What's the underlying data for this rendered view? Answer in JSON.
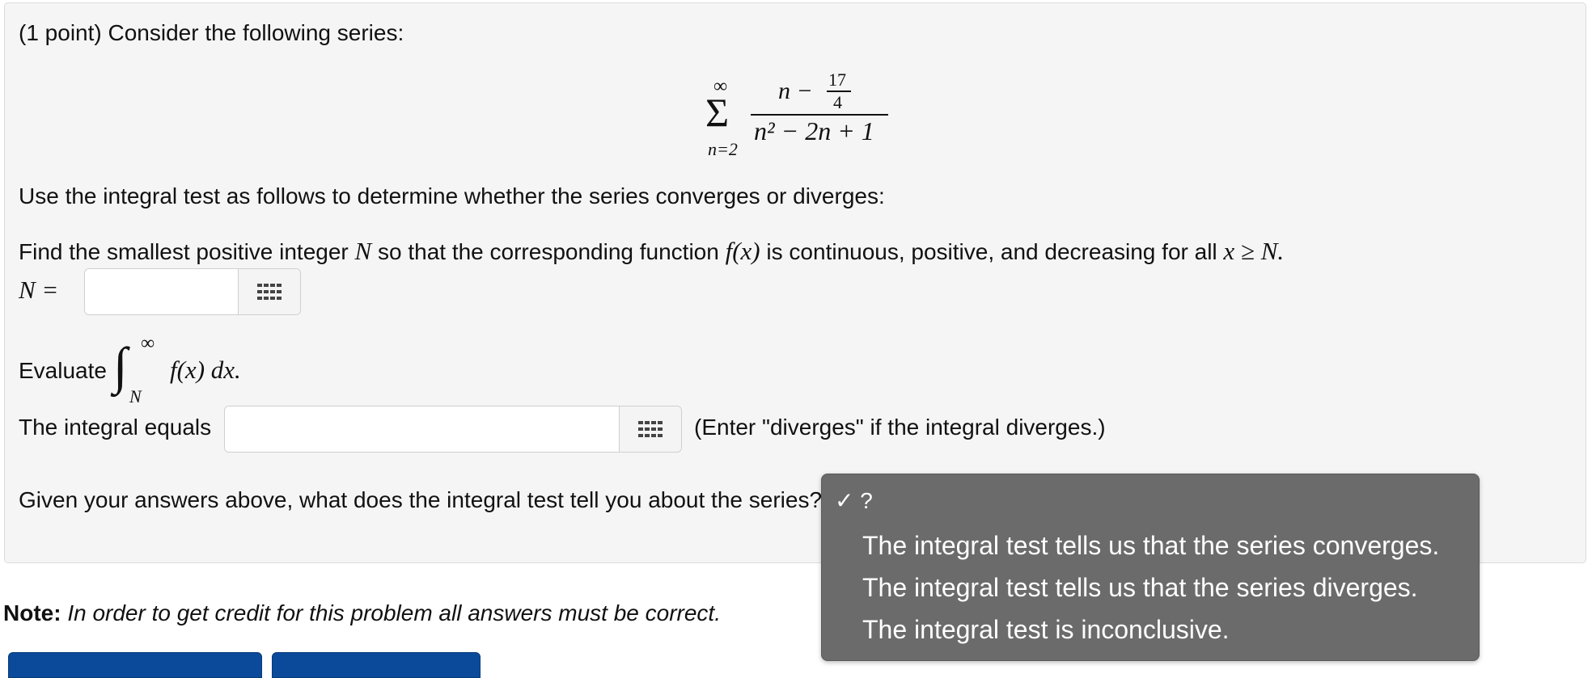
{
  "problem": {
    "intro": "(1 point) Consider the following series:",
    "series": {
      "upper": "∞",
      "lower": "n=2",
      "sigma": "Σ",
      "num_var": "n −",
      "frac_num": "17",
      "frac_den": "4",
      "den": "n² − 2n + 1"
    },
    "instruction": "Use the integral test as follows to determine whether the series converges or diverges:",
    "find_parts": {
      "a": "Find the smallest positive integer ",
      "N": "N",
      "b": " so that the corresponding function ",
      "fx": "f(x)",
      "c": " is continuous, positive, and decreasing for all ",
      "xgeN": "x ≥ N."
    },
    "n_label": "N =",
    "n_value": "",
    "evaluate": {
      "label": "Evaluate",
      "integral": "∫",
      "upper": "∞",
      "lower": "N",
      "integrand": "f(x) dx."
    },
    "integral_label": "The integral equals",
    "integral_value": "",
    "integral_hint": "(Enter \"diverges\" if the integral diverges.)",
    "question": "Given your answers above, what does the integral test tell you about the series?"
  },
  "dropdown": {
    "selected_mark": "✓ ?",
    "options": [
      "The integral test tells us that the series converges.",
      "The integral test tells us that the series diverges.",
      "The integral test is inconclusive."
    ]
  },
  "note": {
    "label": "Note:",
    "text": "In order to get credit for this problem all answers must be correct."
  },
  "colors": {
    "panel_bg": "#f5f5f5",
    "dropdown_bg": "#6b6b6b",
    "button_blue": "#0b4a9a"
  }
}
